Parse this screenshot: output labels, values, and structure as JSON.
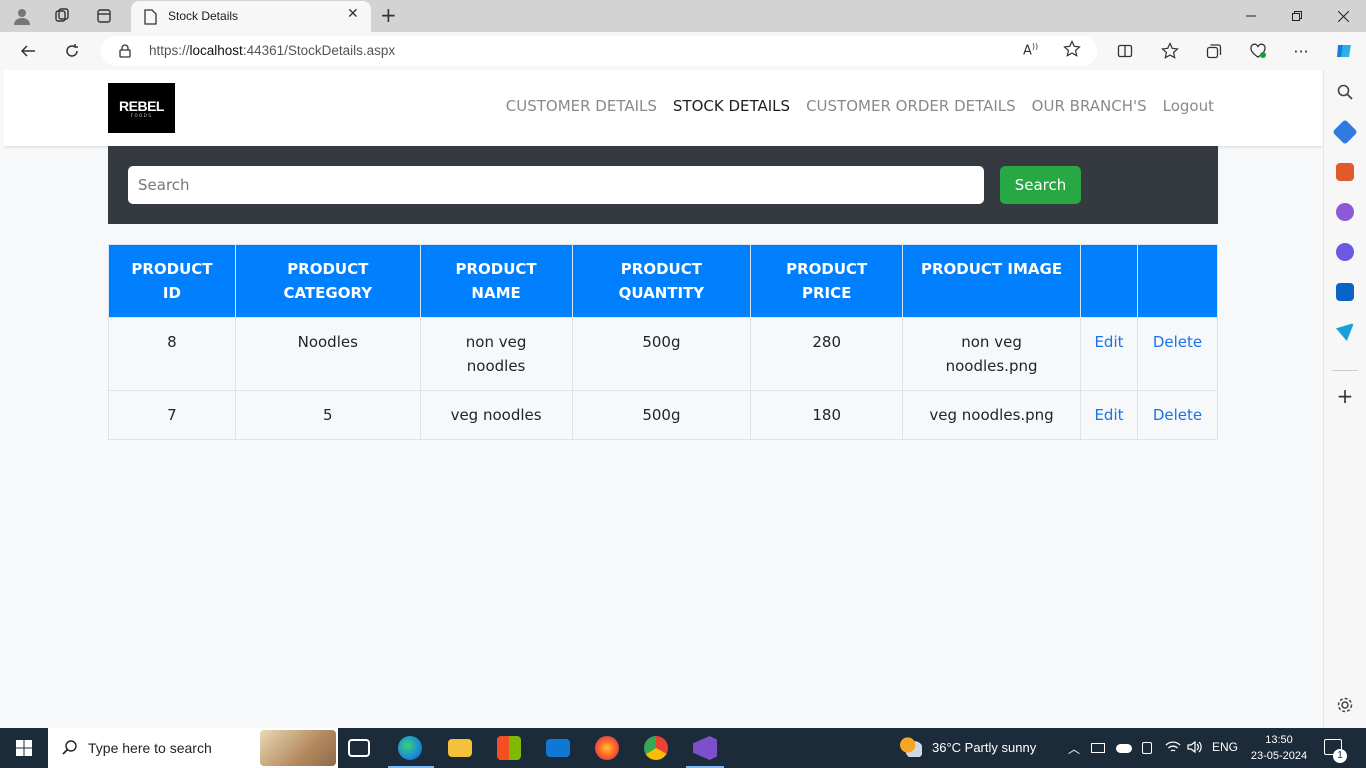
{
  "browser": {
    "tab_title": "Stock Details",
    "url_prefix": "https://",
    "url_host": "localhost",
    "url_rest": ":44361/StockDetails.aspx",
    "close_glyph": "✕",
    "newtab_glyph": "+"
  },
  "site": {
    "logo_text": "REBEL",
    "logo_subtext": "FOODS",
    "nav": [
      {
        "label": "CUSTOMER DETAILS"
      },
      {
        "label": "STOCK DETAILS"
      },
      {
        "label": "CUSTOMER ORDER DETAILS"
      },
      {
        "label": "OUR BRANCH'S"
      },
      {
        "label": "Logout"
      }
    ]
  },
  "search": {
    "placeholder": "Search",
    "button_label": "Search"
  },
  "table": {
    "headers": [
      {
        "line1": "PRODUCT",
        "line2": "ID"
      },
      {
        "line1": "PRODUCT",
        "line2": "CATEGORY"
      },
      {
        "line1": "PRODUCT",
        "line2": "NAME"
      },
      {
        "line1": "PRODUCT",
        "line2": "QUANTITY"
      },
      {
        "line1": "PRODUCT",
        "line2": "PRICE"
      },
      {
        "line1": "PRODUCT IMAGE",
        "line2": ""
      }
    ],
    "rows": [
      {
        "id": "8",
        "category": "Noodles",
        "name": "non veg noodles",
        "quantity": "500g",
        "price": "280",
        "image": "non veg noodles.png",
        "edit": "Edit",
        "delete": "Delete"
      },
      {
        "id": "7",
        "category": "5",
        "name": "veg noodles",
        "quantity": "500g",
        "price": "180",
        "image": "veg noodles.png",
        "edit": "Edit",
        "delete": "Delete"
      }
    ]
  },
  "taskbar": {
    "search_placeholder": "Type here to search",
    "weather": "36°C  Partly sunny",
    "language": "ENG",
    "time": "13:50",
    "date": "23-05-2024",
    "notification_count": "1"
  },
  "colors": {
    "table_header": "#0080ff",
    "search_button": "#28a745",
    "search_band": "#343a40",
    "link": "#1a73e8"
  }
}
